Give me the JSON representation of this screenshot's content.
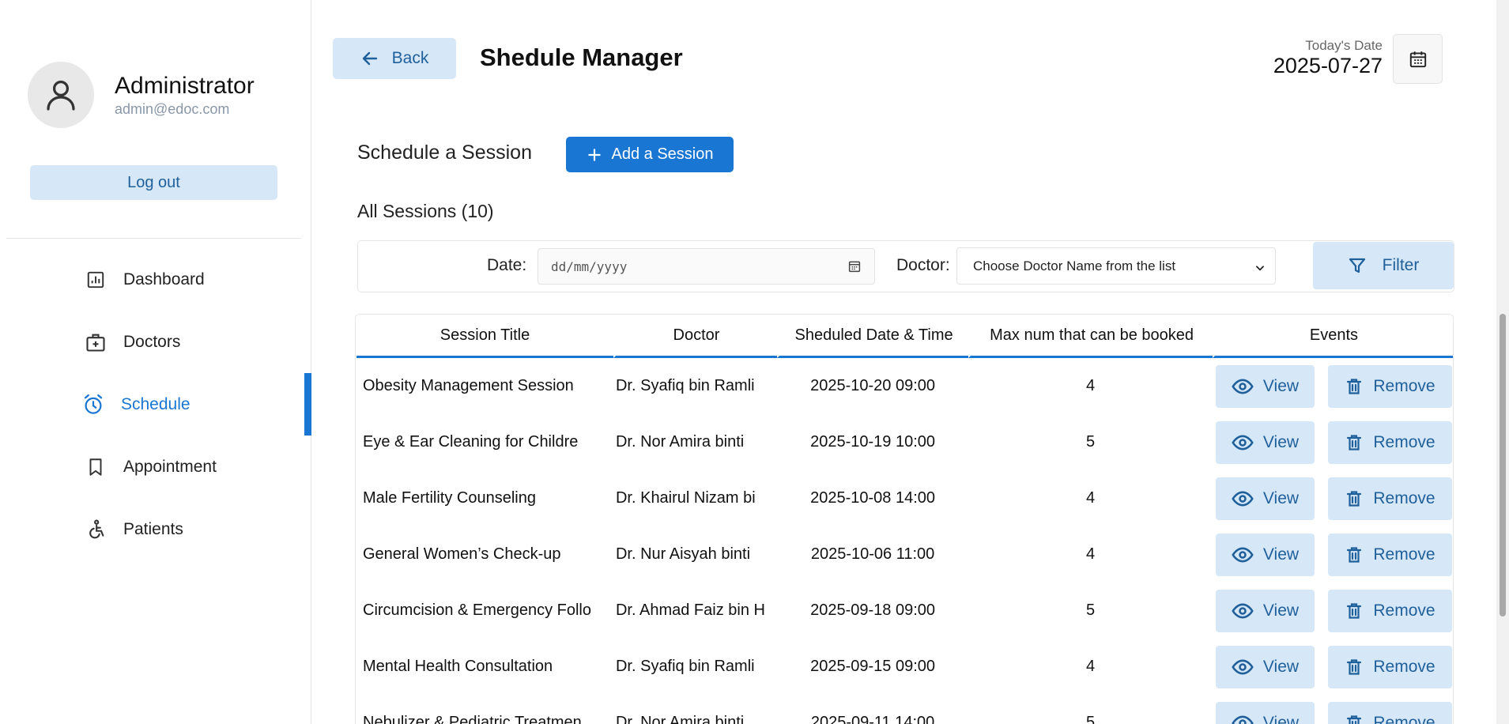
{
  "profile": {
    "name": "Administrator",
    "email": "admin@edoc.com"
  },
  "sidebar": {
    "logout_label": "Log out",
    "items": [
      {
        "label": "Dashboard",
        "icon": "dashboard-icon",
        "active": false
      },
      {
        "label": "Doctors",
        "icon": "doctor-bag-icon",
        "active": false
      },
      {
        "label": "Schedule",
        "icon": "alarm-clock-icon",
        "active": true
      },
      {
        "label": "Appointment",
        "icon": "bookmark-icon",
        "active": false
      },
      {
        "label": "Patients",
        "icon": "wheelchair-icon",
        "active": false
      }
    ]
  },
  "header": {
    "back_label": "Back",
    "title": "Shedule Manager",
    "today_label": "Today's Date",
    "today_value": "2025-07-27"
  },
  "section": {
    "title": "Schedule a Session",
    "add_label": "Add a Session",
    "all_sessions": "All Sessions (10)"
  },
  "filters": {
    "date_label": "Date:",
    "date_placeholder": "dd/mm/yyyy",
    "doctor_label": "Doctor:",
    "doctor_selected": "Choose Doctor Name from the list",
    "filter_label": "Filter"
  },
  "table": {
    "headers": [
      "Session Title",
      "Doctor",
      "Sheduled Date & Time",
      "Max num that can be booked",
      "Events"
    ],
    "view_label": "View",
    "remove_label": "Remove",
    "rows": [
      {
        "title": "Obesity Management Session",
        "doctor": "Dr. Syafiq bin Ramli",
        "datetime": "2025-10-20 09:00",
        "max": "4"
      },
      {
        "title": "Eye & Ear Cleaning for Childre",
        "doctor": "Dr. Nor Amira binti",
        "datetime": "2025-10-19 10:00",
        "max": "5"
      },
      {
        "title": "Male Fertility Counseling",
        "doctor": "Dr. Khairul Nizam bi",
        "datetime": "2025-10-08 14:00",
        "max": "4"
      },
      {
        "title": "General Women’s Check-up",
        "doctor": "Dr. Nur Aisyah binti",
        "datetime": "2025-10-06 11:00",
        "max": "4"
      },
      {
        "title": "Circumcision & Emergency Follo",
        "doctor": "Dr. Ahmad Faiz bin H",
        "datetime": "2025-09-18 09:00",
        "max": "5"
      },
      {
        "title": "Mental Health Consultation",
        "doctor": "Dr. Syafiq bin Ramli",
        "datetime": "2025-09-15 09:00",
        "max": "4"
      },
      {
        "title": "Nebulizer & Pediatric Treatmen",
        "doctor": "Dr. Nor Amira binti",
        "datetime": "2025-09-11 14:00",
        "max": "5"
      }
    ]
  },
  "colors": {
    "accent": "#1976d2",
    "button_bg": "#d6e8f8",
    "button_text": "#1f5f9a"
  }
}
